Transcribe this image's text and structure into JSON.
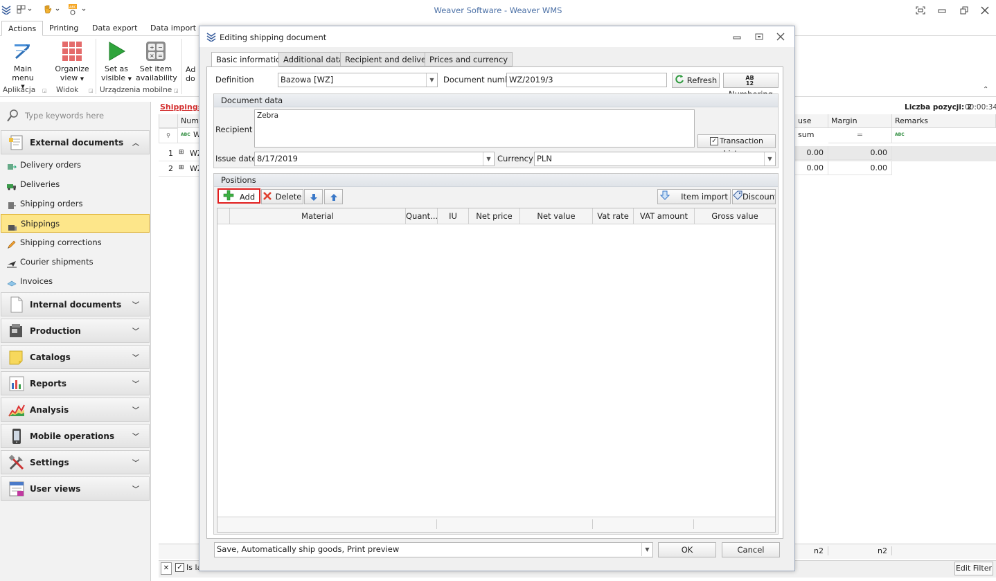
{
  "app": {
    "title": "Weaver Software - Weaver WMS",
    "colors": {
      "accent": "#4a6fa5",
      "selected_bg": "#fde68a",
      "highlight_red": "#e11d1d",
      "link_red": "#d32f2f"
    }
  },
  "ribbon": {
    "tabs": [
      "Actions",
      "Printing",
      "Data export",
      "Data import"
    ],
    "buttons": {
      "main_menu": "Main menu",
      "organize_view_1": "Organize",
      "organize_view_2": "view",
      "set_as_visible_1": "Set as",
      "set_as_visible_2": "visible",
      "set_item_availability_1": "Set item",
      "set_item_availability_2": "availability",
      "add_doc_1": "Ad",
      "add_doc_2": "do"
    },
    "groups": {
      "aplikacja": "Aplikacja",
      "widok": "Widok",
      "urzadzenia": "Urządzenia mobilne"
    }
  },
  "nav": {
    "search_placeholder": "Type keywords here",
    "external_documents": "External documents",
    "items": {
      "delivery_orders": "Delivery orders",
      "deliveries": "Deliveries",
      "shipping_orders": "Shipping orders",
      "shippings": "Shippings",
      "shipping_corrections": "Shipping corrections",
      "courier_shipments": "Courier shipments",
      "invoices": "Invoices"
    },
    "groups": {
      "internal_documents": "Internal documents",
      "production": "Production",
      "catalogs": "Catalogs",
      "reports": "Reports",
      "analysis": "Analysis",
      "mobile_operations": "Mobile operations",
      "settings": "Settings",
      "user_views": "User views"
    }
  },
  "grid": {
    "caption": "Shippings",
    "count_label": "Liczba pozycji: 2",
    "elapsed": "00:00:34",
    "col_number": "Numb",
    "col_use_sum": "use sum",
    "col_margin": "Margin",
    "col_remarks": "Remarks",
    "filter_abc": "ABC",
    "filter_w": "W",
    "filter_eq": "=",
    "rows": [
      {
        "idx": "1",
        "num": "WZ",
        "use_sum": "0.00",
        "margin": "0.00"
      },
      {
        "idx": "2",
        "num": "WZ",
        "use_sum": "0.00",
        "margin": "0.00"
      }
    ],
    "footer_n2_a": "n2",
    "footer_n2_b": "n2",
    "footer_is_label": "Is la",
    "edit_filter": "Edit Filter"
  },
  "dialog": {
    "title": "Editing shipping document",
    "tabs": [
      "Basic information",
      "Additional data",
      "Recipient and delivery",
      "Prices and currency"
    ],
    "definition_label": "Definition",
    "definition_value": "Bazowa [WZ]",
    "docnum_label": "Document number",
    "docnum_value": "WZ/2019/3",
    "refresh": "Refresh",
    "numbering": "Numbering",
    "document_data": "Document data",
    "recipient_label": "Recipient",
    "recipient_value": "Zebra",
    "transaction_history": "Transaction history",
    "issue_date_label": "Issue date",
    "issue_date_value": "8/17/2019",
    "currency_label": "Currency",
    "currency_value": "PLN",
    "positions": "Positions",
    "add": "Add",
    "delete": "Delete",
    "item_import": "Item import",
    "discount": "Discount",
    "columns": [
      "Material",
      "Quant...",
      "IU",
      "Net price",
      "Net value",
      "Vat rate",
      "VAT amount",
      "Gross value"
    ],
    "save_option": "Save, Automatically ship goods, Print preview",
    "ok": "OK",
    "cancel": "Cancel"
  }
}
